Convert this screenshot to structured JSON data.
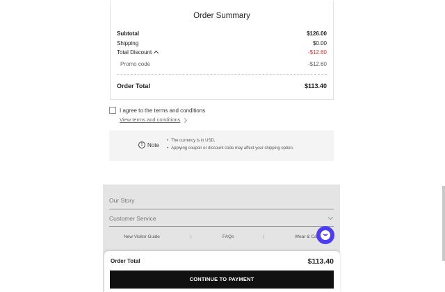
{
  "summary": {
    "title": "Order Summary",
    "rows": [
      {
        "label": "Subtotal",
        "value": "$126.00"
      },
      {
        "label": "Shipping",
        "value": "$0.00"
      },
      {
        "label": "Total Discount",
        "value": "-$12.60"
      },
      {
        "label": "Promo code",
        "value": "-$12.60"
      }
    ],
    "total_label": "Order Total",
    "total_value": "$113.40"
  },
  "terms": {
    "agree_label": "I agree to the terms and conditions",
    "view_link": "View terms and conditions"
  },
  "note": {
    "label": "Note",
    "icon": "!",
    "lines": [
      "The currency is in USD.",
      "Applying coupon or discount code may affect your shipping option."
    ]
  },
  "footer": {
    "items": [
      "Our Story",
      "Customer Service"
    ],
    "links": [
      "New Visitor Guide",
      "FAQs",
      "Wear & Care"
    ]
  },
  "checkout": {
    "label": "Order Total",
    "total": "$113.40",
    "button": "CONTINUE TO PAYMENT"
  },
  "colors": {
    "discount": "#e0362c",
    "chat": "#4c3df5",
    "button": "#111111"
  }
}
